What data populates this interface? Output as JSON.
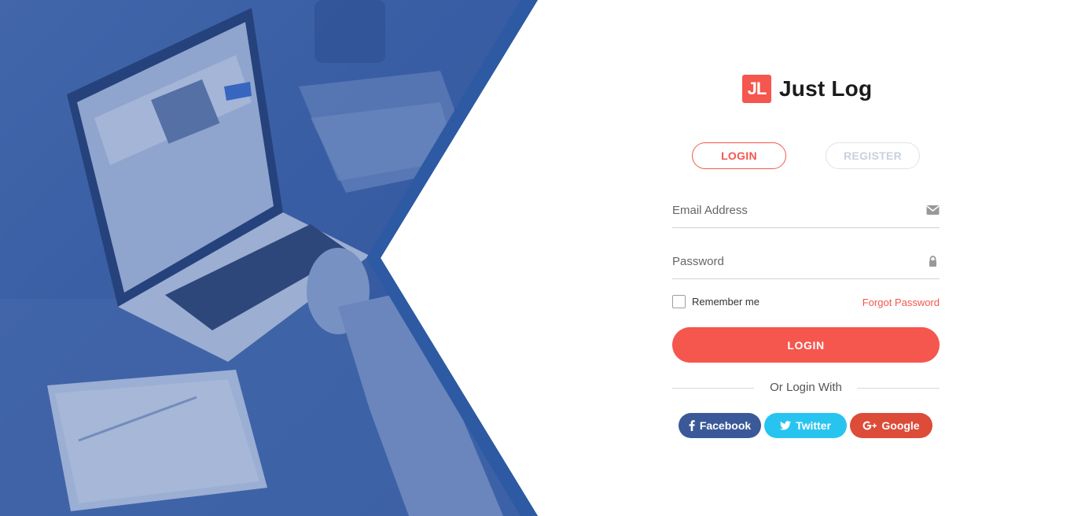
{
  "brand": {
    "logo_text": "JL",
    "name": "Just Log"
  },
  "tabs": {
    "login_label": "LOGIN",
    "register_label": "REGISTER"
  },
  "form": {
    "email": {
      "placeholder": "Email Address",
      "value": "",
      "icon": "envelope-icon"
    },
    "password": {
      "placeholder": "Password",
      "value": "",
      "icon": "lock-icon"
    },
    "remember_label": "Remember me",
    "remember_checked": false,
    "forgot_label": "Forgot Password",
    "submit_label": "LOGIN"
  },
  "social": {
    "divider_text": "Or Login With",
    "facebook_label": "Facebook",
    "twitter_label": "Twitter",
    "google_label": "Google"
  },
  "colors": {
    "accent": "#f5564e",
    "hero_blue": "#3f62a6",
    "facebook": "#3b5998",
    "twitter": "#28c4f0",
    "google": "#dd4b39"
  }
}
